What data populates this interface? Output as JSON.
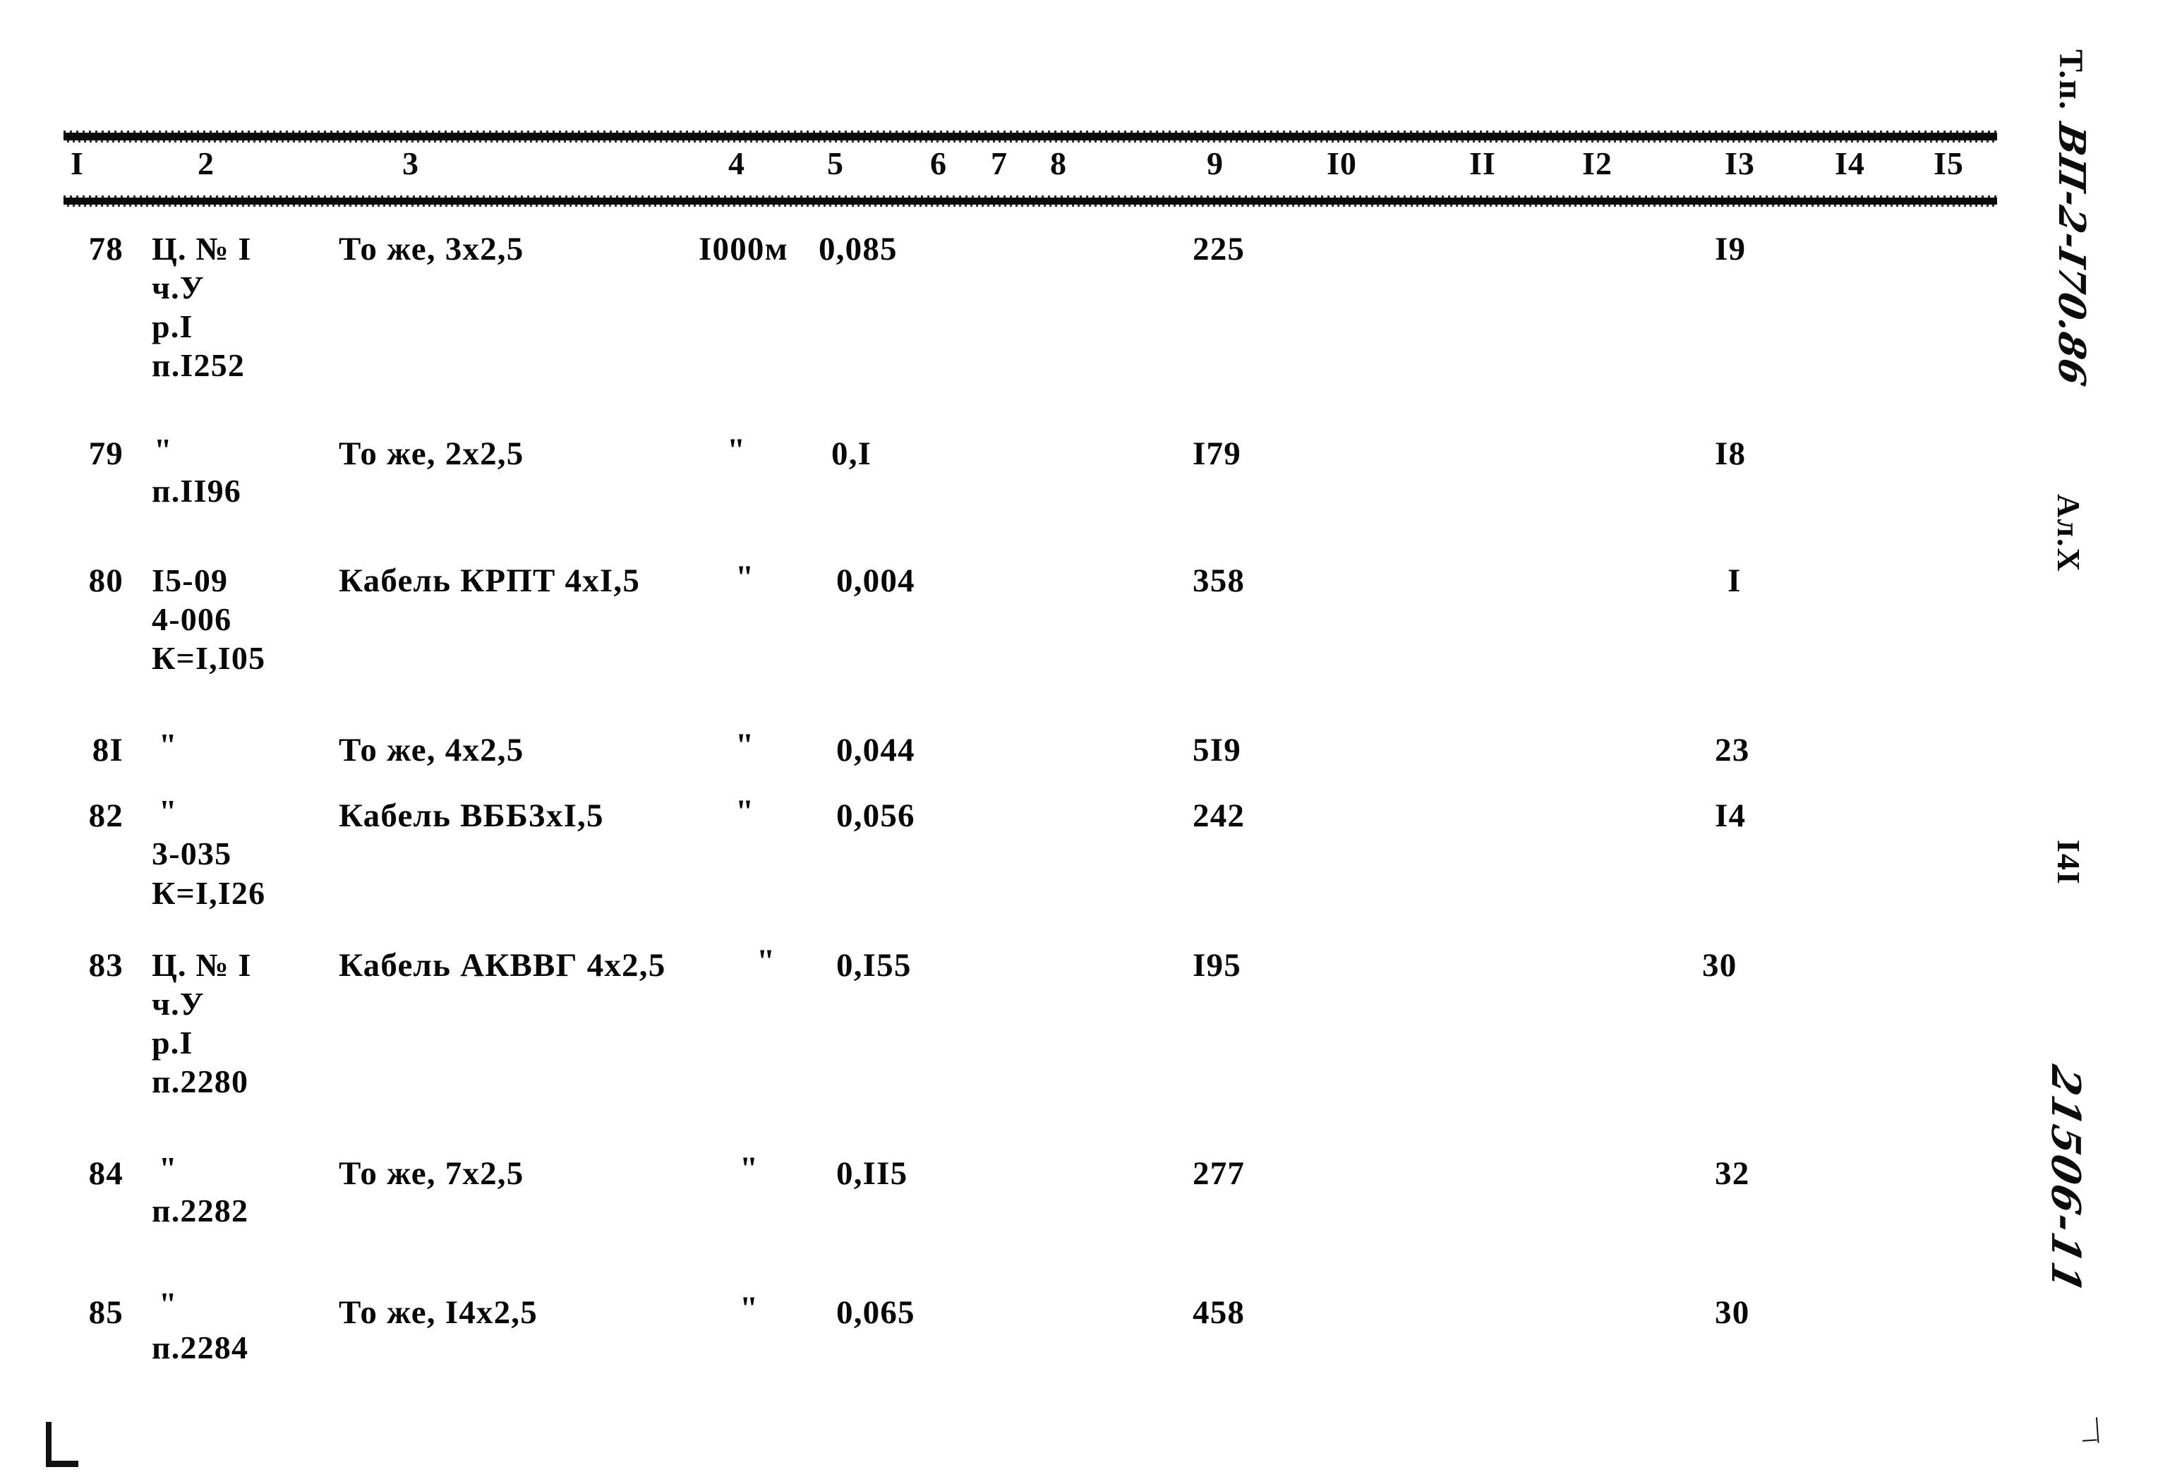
{
  "document": {
    "type": "typewritten-specification-table",
    "page_number": "I4I",
    "album": "Ал.X",
    "stamp_prefix": "Т.п.",
    "stamp_code": "ВП-2-I70.86",
    "order_number": "21506-11",
    "corner_tick": "_|"
  },
  "table": {
    "column_numbers": [
      "I",
      "2",
      "3",
      "4",
      "5",
      "6",
      "7",
      "8",
      "9",
      "I0",
      "II",
      "I2",
      "I3",
      "I4",
      "I5"
    ],
    "rows": [
      {
        "pos": "78",
        "code_lines": [
          "Ц. № I",
          "ч.У",
          "р.I",
          "п.I252"
        ],
        "name": "То же, 3х2,5",
        "unit": "I000м",
        "qty": "0,085",
        "mass": "225",
        "col13": "I9"
      },
      {
        "pos": "79",
        "code_lines": [
          "\"",
          "п.II96"
        ],
        "name": "То же, 2х2,5",
        "unit": "\"",
        "qty": "0,I",
        "mass": "I79",
        "col13": "I8"
      },
      {
        "pos": "80",
        "code_lines": [
          "I5-09",
          "4-006",
          "К=I,I05"
        ],
        "name": "Кабель КРПТ 4хI,5",
        "unit": "\"",
        "qty": "0,004",
        "mass": "358",
        "col13": "I"
      },
      {
        "pos": "8I",
        "code_lines": [
          "\""
        ],
        "name": "То же, 4х2,5",
        "unit": "\"",
        "qty": "0,044",
        "mass": "5I9",
        "col13": "23"
      },
      {
        "pos": "82",
        "code_lines": [
          "\"",
          "3-035",
          "К=I,I26"
        ],
        "name": "Кабель ВББ3хI,5",
        "unit": "\"",
        "qty": "0,056",
        "mass": "242",
        "col13": "I4"
      },
      {
        "pos": "83",
        "code_lines": [
          "Ц. № I",
          "ч.У",
          "р.I",
          "п.2280"
        ],
        "name": "Кабель АКВВГ 4х2,5",
        "unit": "\"",
        "qty": "0,I55",
        "mass": "I95",
        "col13": "30"
      },
      {
        "pos": "84",
        "code_lines": [
          "\"",
          "п.2282"
        ],
        "name": "То же, 7х2,5",
        "unit": "\"",
        "qty": "0,II5",
        "mass": "277",
        "col13": "32"
      },
      {
        "pos": "85",
        "code_lines": [
          "\"",
          "п.2284"
        ],
        "name": "То же, I4х2,5",
        "unit": "\"",
        "qty": "0,065",
        "mass": "458",
        "col13": "30"
      }
    ]
  }
}
